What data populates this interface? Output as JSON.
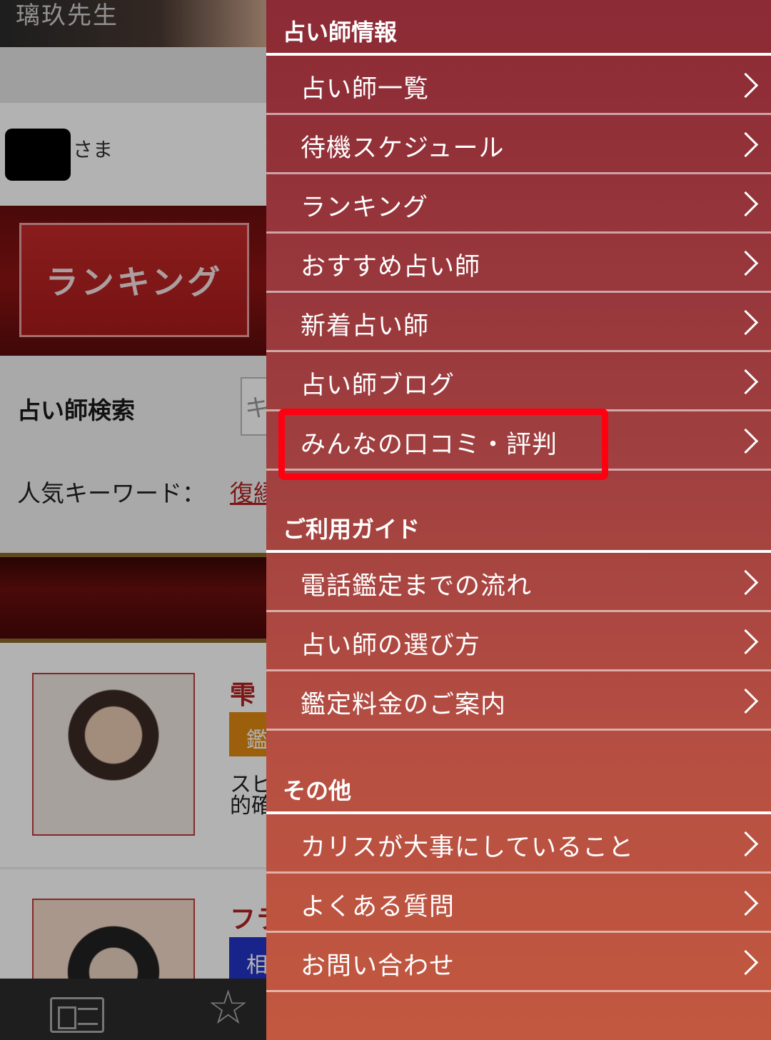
{
  "background_page": {
    "hero_name": "璃玖先生",
    "user_suffix": "さま",
    "ranking_banner": "ランキング",
    "search_label": "占い師検索",
    "search_placeholder": "キ",
    "keywords_label": "人気キーワード：",
    "keyword_first": "復縁",
    "fortune_tellers": [
      {
        "name": "雫",
        "tag": "鑑",
        "desc": "スピ的確"
      },
      {
        "name": "フラ",
        "tag": "相"
      }
    ]
  },
  "drawer": {
    "sections": [
      {
        "title": "占い師情報",
        "items": [
          {
            "label": "占い師一覧"
          },
          {
            "label": "待機スケジュール"
          },
          {
            "label": "ランキング"
          },
          {
            "label": "おすすめ占い師"
          },
          {
            "label": "新着占い師"
          },
          {
            "label": "占い師ブログ"
          },
          {
            "label": "みんなの口コミ・評判"
          }
        ]
      },
      {
        "title": "ご利用ガイド",
        "items": [
          {
            "label": "電話鑑定までの流れ"
          },
          {
            "label": "占い師の選び方"
          },
          {
            "label": "鑑定料金のご案内"
          }
        ]
      },
      {
        "title": "その他",
        "items": [
          {
            "label": "カリスが大事にしていること"
          },
          {
            "label": "よくある質問"
          },
          {
            "label": "お問い合わせ"
          }
        ]
      }
    ]
  },
  "highlight_color": "#ff0011",
  "drawer_color_top": "#8c2a35",
  "drawer_color_bottom": "#c2583f"
}
